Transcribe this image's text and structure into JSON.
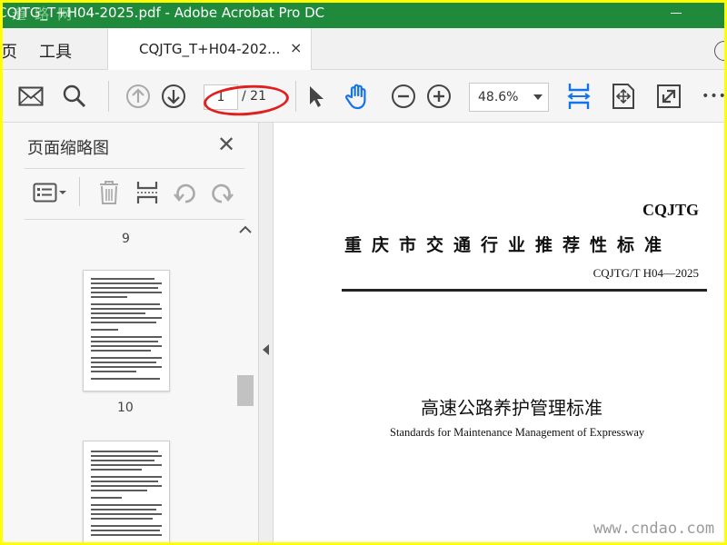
{
  "window": {
    "title": "CQJTG_T+H04-2025.pdf - Adobe Acrobat Pro DC",
    "watermark_top": "道 路 网"
  },
  "menu": {
    "home": "页",
    "tools": "工具"
  },
  "tab": {
    "label": "CQJTG_T+H04-202...",
    "close": "×"
  },
  "toolbar": {
    "current_page": "1",
    "total_pages": "/ 21",
    "zoom": "48.6%",
    "more": "•••"
  },
  "thumbnail_panel": {
    "title": "页面缩略图",
    "close": "✕",
    "pages": [
      "9",
      "10"
    ]
  },
  "document": {
    "code": "CQJTG",
    "subtitle": "重庆市交通行业推荐性标准",
    "number": "CQJTG/T H04—2025",
    "title_cn": "高速公路养护管理标准",
    "title_en": "Standards for Maintenance Management of Expressway"
  },
  "watermark_bottom": "www.cndao.com",
  "colors": {
    "titlebar": "#1f8a3c",
    "accent_blue": "#1473e6",
    "annotation_red": "#e02020",
    "frame_yellow": "#ffff00"
  }
}
